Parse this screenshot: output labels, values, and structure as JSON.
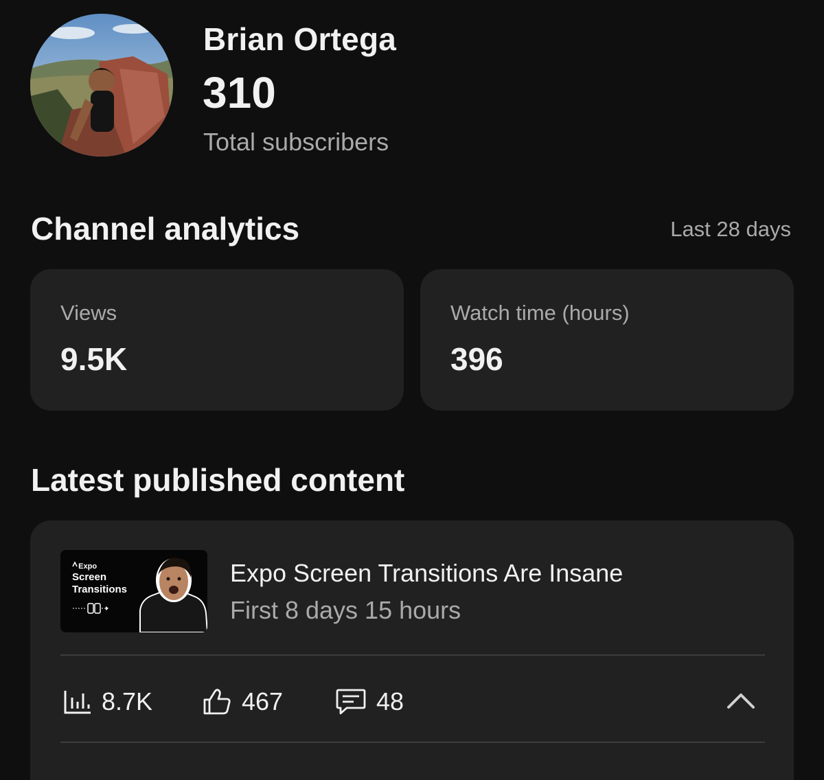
{
  "profile": {
    "channel_name": "Brian Ortega",
    "subscriber_count": "310",
    "subscriber_label": "Total subscribers"
  },
  "analytics": {
    "title": "Channel analytics",
    "range": "Last 28 days",
    "cards": [
      {
        "label": "Views",
        "value": "9.5K"
      },
      {
        "label": "Watch time (hours)",
        "value": "396"
      }
    ]
  },
  "latest": {
    "title": "Latest published content",
    "video": {
      "thumbnail": {
        "brand": "Expo",
        "line1": "Screen",
        "line2": "Transitions"
      },
      "title": "Expo Screen Transitions Are Insane",
      "subtitle": "First 8 days 15 hours",
      "metrics": {
        "views": "8.7K",
        "likes": "467",
        "comments": "48"
      }
    }
  },
  "icons": {
    "views": "bar-chart-icon",
    "likes": "thumbs-up-icon",
    "comments": "comment-icon",
    "collapse": "chevron-up-icon"
  },
  "colors": {
    "background": "#0f0f0f",
    "card": "#212121",
    "text_primary": "#f1f1f1",
    "text_secondary": "#aaaaaa"
  }
}
